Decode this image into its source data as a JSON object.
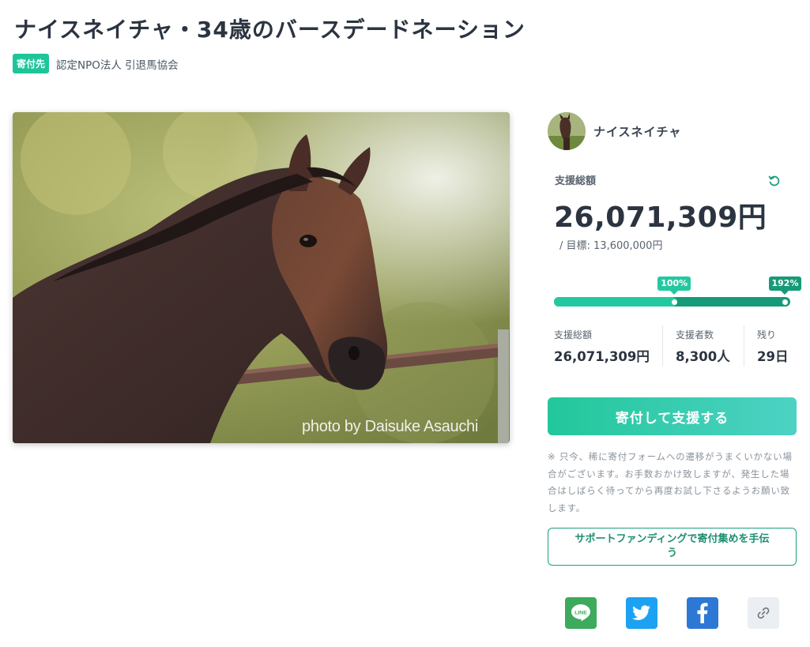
{
  "page": {
    "title": "ナイスネイチャ・34歳のバースデードネーション",
    "org_badge": "寄付先",
    "org_name": "認定NPO法人 引退馬協会"
  },
  "hero": {
    "photo_credit": "photo by Daisuke Asauchi"
  },
  "sidebar": {
    "owner_name": "ナイスネイチャ",
    "total_label": "支援総額",
    "total_amount": "26,071,309円",
    "goal_text": "/ 目標: 13,600,000円",
    "progress": {
      "first_marker_label": "100%",
      "achieved_label": "192%",
      "achieved_ratio": 1.92
    },
    "stats": [
      {
        "label": "支援総額",
        "value": "26,071,309円"
      },
      {
        "label": "支援者数",
        "value": "8,300人"
      },
      {
        "label": "残り",
        "value": "29日"
      }
    ],
    "donate_button": "寄付して支援する",
    "notice": "※ 只今、稀に寄付フォームへの遷移がうまくいかない場合がございます。お手数おかけ致しますが、発生した場合はしばらく待ってから再度お試し下さるようお願い致します。",
    "support_button": "サポートファンディングで寄付集めを手伝う"
  },
  "share": {
    "line_label": "LINE",
    "icons": [
      "line-icon",
      "twitter-icon",
      "facebook-icon",
      "link-icon"
    ]
  },
  "colors": {
    "accent": "#1fc59a",
    "accent_dark": "#179a78",
    "text": "#2b3440",
    "line": "#3daa5c",
    "twitter": "#1da1f2",
    "facebook": "#2d78d4"
  }
}
